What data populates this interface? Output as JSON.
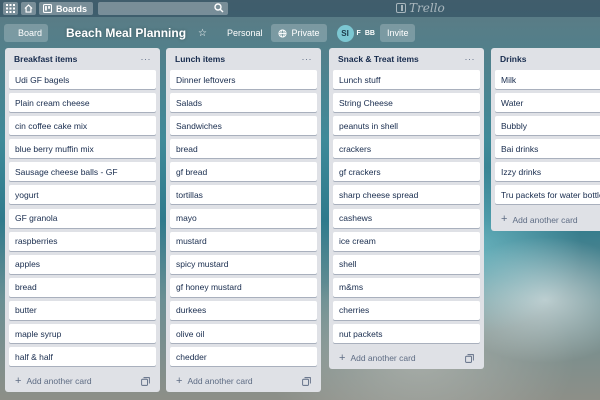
{
  "topbar": {
    "boards_label": "Boards",
    "icons": [
      "apps-grid-icon",
      "home-icon",
      "boards-icon",
      "search-icon"
    ],
    "logo_text": "Trello"
  },
  "board": {
    "dropdown_label": "Board",
    "title": "Beach Meal Planning",
    "personal_label": "Personal",
    "privacy_label": "Private",
    "avatar_initials": "SI",
    "member_initial": "F",
    "member_badge": "BB",
    "invite_label": "Invite"
  },
  "lists": [
    {
      "title": "Breakfast items",
      "cards": [
        "Udi GF bagels",
        "Plain cream cheese",
        "cin coffee cake mix",
        "blue berry muffin mix",
        "Sausage cheese balls - GF",
        "yogurt",
        "GF granola",
        "raspberries",
        "apples",
        "bread",
        "butter",
        "maple syrup",
        "half & half"
      ],
      "add_label": "Add another card"
    },
    {
      "title": "Lunch items",
      "cards": [
        "Dinner leftovers",
        "Salads",
        "Sandwiches",
        "bread",
        "gf bread",
        "tortillas",
        "mayo",
        "mustard",
        "spicy mustard",
        "gf honey mustard",
        "durkees",
        "olive oil",
        "chedder"
      ],
      "add_label": "Add another card"
    },
    {
      "title": "Snack & Treat items",
      "cards": [
        "Lunch stuff",
        "String Cheese",
        "peanuts in shell",
        "crackers",
        "gf crackers",
        "sharp cheese spread",
        "cashews",
        "ice cream",
        "shell",
        "m&ms",
        "cherries",
        "nut packets"
      ],
      "add_label": "Add another card"
    },
    {
      "title": "Drinks",
      "cards": [
        "Milk",
        "Water",
        "Bubbly",
        "Bai drinks",
        "Izzy drinks",
        "Tru packets for water bottles"
      ],
      "add_label": "Add another card"
    }
  ],
  "colors": {
    "list_bg": "#dfe1e6",
    "card_bg": "#ffffff",
    "text": "#172b4d",
    "muted": "#5e6c84",
    "avatar_bg": "#7cc7d2"
  }
}
